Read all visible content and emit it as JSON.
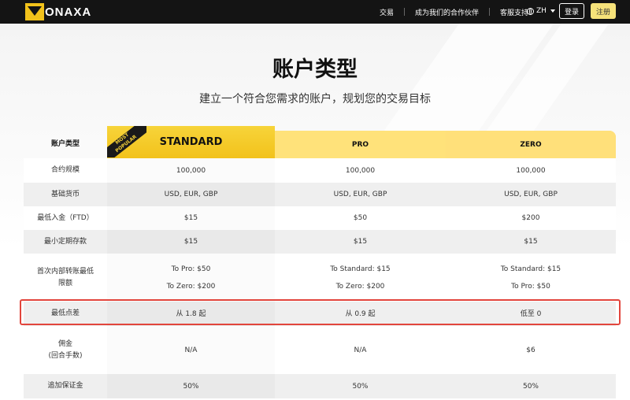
{
  "nav": {
    "logo_text": "ONAXA",
    "links": [
      "交易",
      "成为我们的合作伙伴",
      "客服支持"
    ],
    "lang": "ZH",
    "login": "登录",
    "register": "注册"
  },
  "hero": {
    "title": "账户类型",
    "subtitle": "建立一个符合您需求的账户，规划您的交易目标"
  },
  "table": {
    "header_label": "账户类型",
    "ribbon": [
      "MOST",
      "POPULAR"
    ],
    "columns": [
      "STANDARD",
      "PRO",
      "ZERO"
    ],
    "rows": [
      {
        "label": [
          "合约规模"
        ],
        "values": [
          [
            "100,000"
          ],
          [
            "100,000"
          ],
          [
            "100,000"
          ]
        ]
      },
      {
        "label": [
          "基础货币"
        ],
        "values": [
          [
            "USD, EUR, GBP"
          ],
          [
            "USD, EUR, GBP"
          ],
          [
            "USD, EUR, GBP"
          ]
        ]
      },
      {
        "label": [
          "最低入金（FTD）"
        ],
        "values": [
          [
            "$15"
          ],
          [
            "$50"
          ],
          [
            "$200"
          ]
        ]
      },
      {
        "label": [
          "最小定期存款"
        ],
        "values": [
          [
            "$15"
          ],
          [
            "$15"
          ],
          [
            "$15"
          ]
        ]
      },
      {
        "label": [
          "首次内部转账最低",
          "限额"
        ],
        "values": [
          [
            "To Pro: $50",
            "To Zero: $200"
          ],
          [
            "To Standard: $15",
            "To Zero: $200"
          ],
          [
            "To Standard: $15",
            "To Pro: $50"
          ]
        ]
      },
      {
        "label": [
          "最低点差"
        ],
        "values": [
          [
            "从 1.8 起"
          ],
          [
            "从 0.9 起"
          ],
          [
            "低至 0"
          ]
        ]
      },
      {
        "label": [
          "佣金",
          "(回合手数)"
        ],
        "values": [
          [
            "N/A"
          ],
          [
            "N/A"
          ],
          [
            "$6"
          ]
        ]
      },
      {
        "label": [
          "追加保证金"
        ],
        "values": [
          [
            "50%"
          ],
          [
            "50%"
          ],
          [
            "50%"
          ]
        ]
      }
    ]
  },
  "colors": {
    "nav_bg": "#141414",
    "accent": "#f2c21b",
    "header_yellow": "#ffe27a",
    "highlight_border": "#e2453c"
  }
}
